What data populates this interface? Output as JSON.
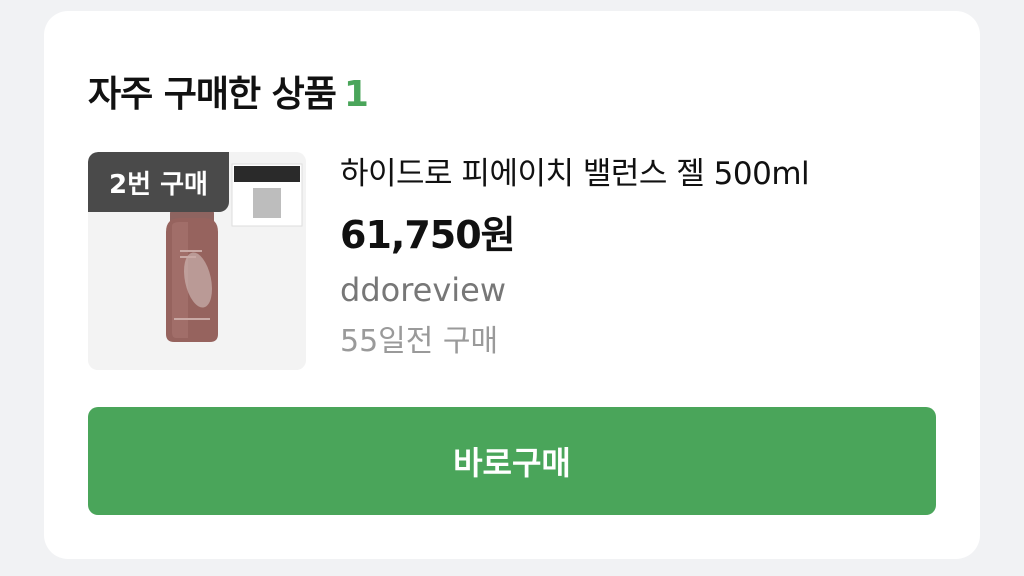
{
  "section": {
    "title": "자주 구매한 상품",
    "count": "1"
  },
  "product": {
    "badge": "2번 구매",
    "name": "하이드로 피에이치 밸런스 젤 500ml",
    "price": "61,750원",
    "seller": "ddoreview",
    "purchased_ago": "55일전 구매"
  },
  "actions": {
    "buy_now_label": "바로구매"
  },
  "colors": {
    "accent": "#4aa55a",
    "badge_bg": "#4a4a4a",
    "card_bg": "#ffffff",
    "page_bg": "#f1f2f4"
  },
  "icons": {
    "product_image": "bottle-product-image"
  }
}
